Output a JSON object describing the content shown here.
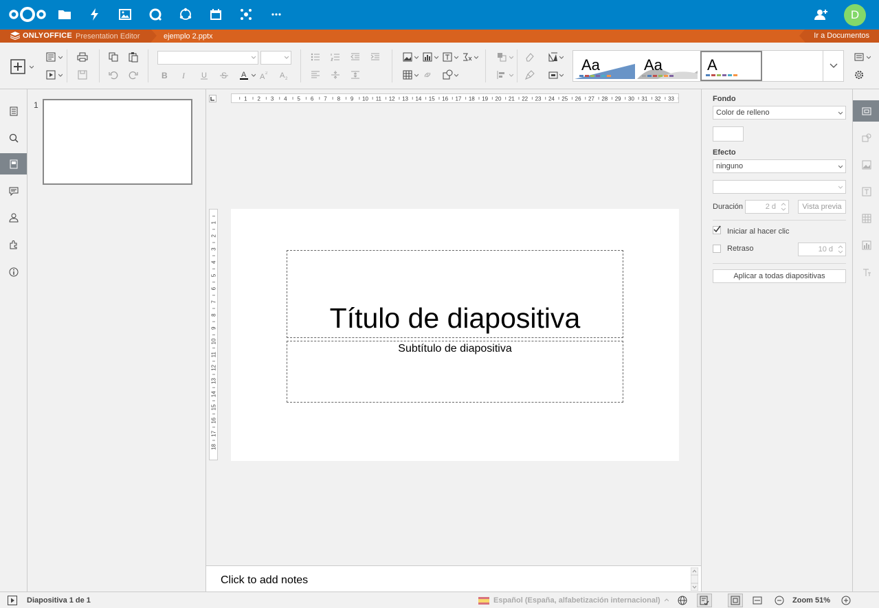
{
  "nextcloud": {
    "apps": [
      "files-icon",
      "activity-icon",
      "gallery-icon",
      "talk-icon",
      "circles-icon",
      "calendar-icon",
      "social-icon",
      "more-apps-icon"
    ],
    "avatar_initial": "D",
    "colors": {
      "header_bg": "#0082c9",
      "avatar_bg": "#83d869"
    }
  },
  "onlyoffice": {
    "brand": "ONLYOFFICE",
    "editor_name": "Presentation Editor",
    "document_name": "ejemplo 2.pptx",
    "go_to_documents": "Ir a Documentos",
    "colors": {
      "titlebar_bg": "#d8621f"
    }
  },
  "toolbar": {
    "font_name": "",
    "font_size": "",
    "themes": [
      {
        "label": "Aa",
        "bars": [
          "#4f81bd",
          "#c0504d",
          "#9bbb59",
          "#8064a2",
          "#4bacc6",
          "#f79646"
        ]
      },
      {
        "label": "Aa",
        "bars": [
          "#a5a5a5",
          "#4f81bd",
          "#c0504d",
          "#9bbb59",
          "#f79646",
          "#8064a2"
        ]
      },
      {
        "label": "A",
        "bars": [
          "#4f81bd",
          "#c0504d",
          "#9bbb59",
          "#8064a2",
          "#4bacc6",
          "#f79646"
        ]
      }
    ]
  },
  "thumbnails": {
    "slide_number": "1"
  },
  "ruler": {
    "h_ticks": [
      "1",
      "2",
      "3",
      "4",
      "5",
      "6",
      "7",
      "8",
      "9",
      "10",
      "11",
      "12",
      "13",
      "14",
      "15",
      "16",
      "17",
      "18",
      "19",
      "20",
      "21",
      "22",
      "23",
      "24",
      "25",
      "26",
      "27",
      "28",
      "29",
      "30",
      "31",
      "32",
      "33"
    ],
    "v_ticks": [
      "1",
      "2",
      "3",
      "4",
      "5",
      "6",
      "7",
      "8",
      "9",
      "10",
      "11",
      "12",
      "13",
      "14",
      "15",
      "16",
      "17",
      "18"
    ]
  },
  "slide": {
    "title": "Título de diapositiva",
    "subtitle": "Subtítulo de diapositiva"
  },
  "notes": {
    "placeholder": "Click to add notes"
  },
  "settings": {
    "background_label": "Fondo",
    "fill_type": "Color de relleno",
    "effect_label": "Efecto",
    "effect_value": "ninguno",
    "effect_type": "",
    "duration_label": "Duración",
    "duration_value": "2 d",
    "preview_button": "Vista previa",
    "start_on_click_label": "Iniciar al hacer clic",
    "start_on_click_checked": true,
    "delay_label": "Retraso",
    "delay_checked": false,
    "delay_value": "10 d",
    "apply_all_button": "Aplicar a todas diapositivas"
  },
  "statusbar": {
    "slide_counter": "Diapositiva 1 de 1",
    "language": "Español (España, alfabetización internacional)",
    "zoom": "Zoom 51%"
  }
}
